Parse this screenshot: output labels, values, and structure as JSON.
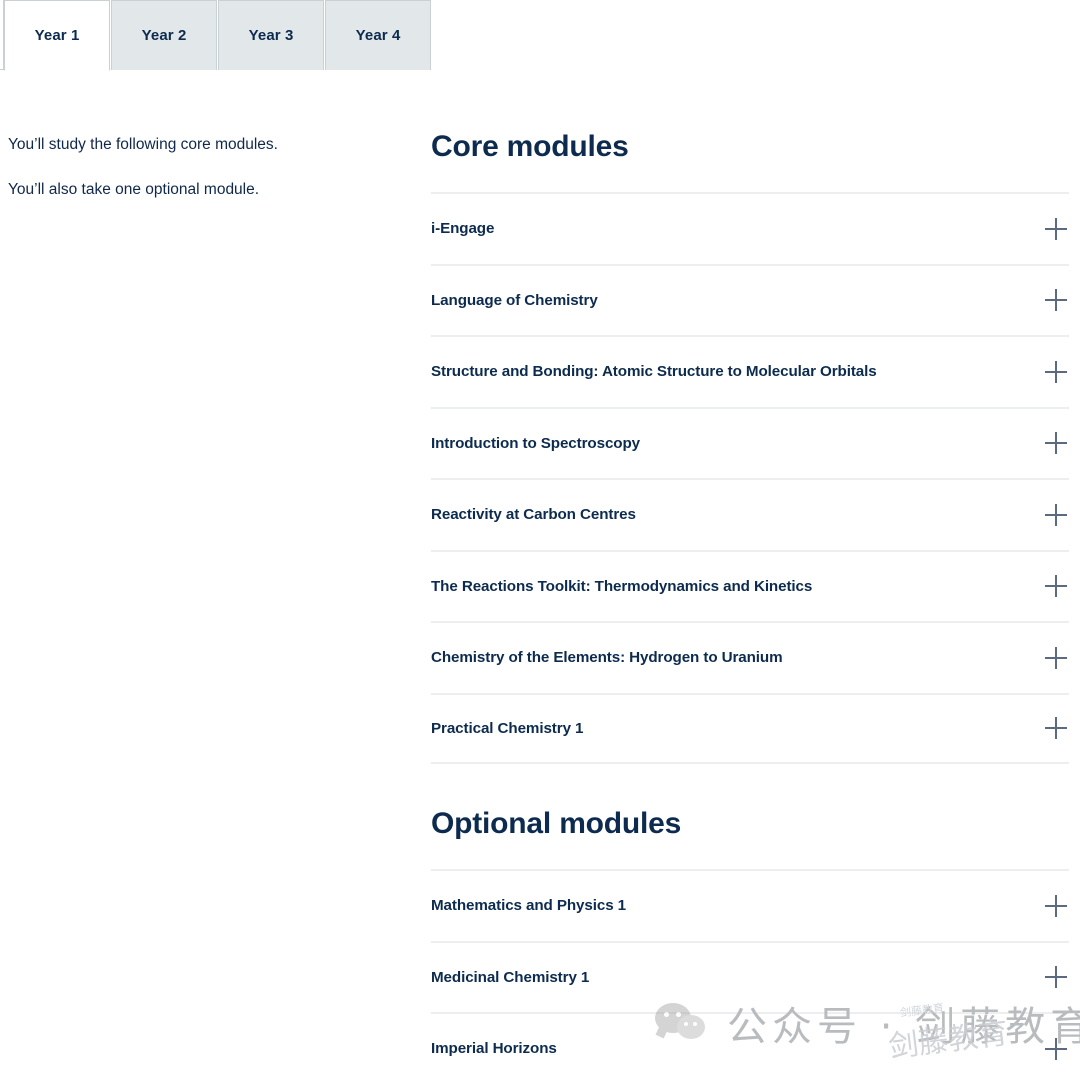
{
  "tabs": {
    "items": [
      {
        "label": "Year 1",
        "active": true
      },
      {
        "label": "Year 2",
        "active": false
      },
      {
        "label": "Year 3",
        "active": false
      },
      {
        "label": "Year 4",
        "active": false
      }
    ]
  },
  "intro": {
    "paragraph_1": "You’ll study the following core modules.",
    "paragraph_2": "You’ll also take one optional module."
  },
  "core_section": {
    "heading": "Core modules",
    "modules": [
      "i-Engage",
      "Language of Chemistry",
      "Structure and Bonding: Atomic Structure to Molecular Orbitals",
      "Introduction to Spectroscopy",
      "Reactivity at Carbon Centres",
      "The Reactions Toolkit: Thermodynamics and Kinetics",
      "Chemistry of the Elements: Hydrogen to Uranium",
      "Practical Chemistry 1"
    ]
  },
  "optional_section": {
    "heading": "Optional modules",
    "modules": [
      "Mathematics and Physics 1",
      "Medicinal Chemistry 1",
      "Imperial Horizons"
    ]
  },
  "icons": {
    "expand": "plus-icon"
  },
  "watermark": {
    "text": "公众号 · 剑藤教育",
    "overlay_text": "剑藤教育",
    "overlay_small": "剑藤教育"
  },
  "colors": {
    "navy": "#0d2b4e",
    "tab_inactive": "#e2e7e9",
    "divider": "#eceeef",
    "plus": "#5b6a80"
  }
}
